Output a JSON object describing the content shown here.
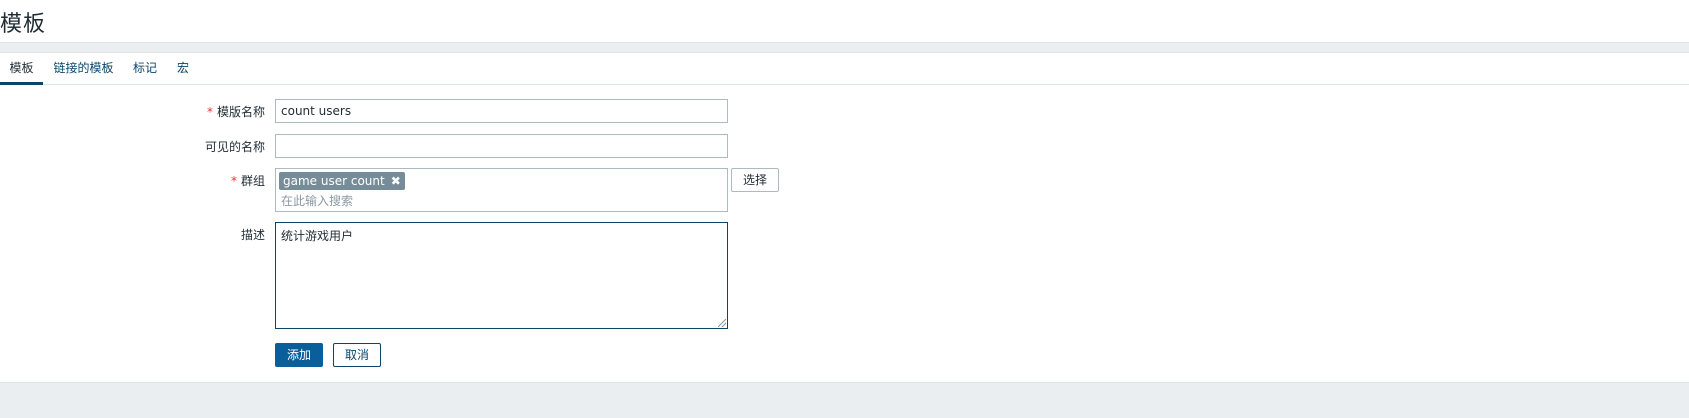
{
  "page": {
    "title": "模板"
  },
  "tabs": [
    {
      "label": "模板",
      "active": true
    },
    {
      "label": "链接的模板",
      "active": false
    },
    {
      "label": "标记",
      "active": false
    },
    {
      "label": "宏",
      "active": false
    }
  ],
  "form": {
    "template_name": {
      "label": "模版名称",
      "required": true,
      "value": "count users"
    },
    "visible_name": {
      "label": "可见的名称",
      "required": false,
      "value": ""
    },
    "groups": {
      "label": "群组",
      "required": true,
      "tags": [
        "game user count"
      ],
      "search_placeholder": "在此输入搜索",
      "select_button": "选择"
    },
    "description": {
      "label": "描述",
      "value": "统计游戏用户"
    },
    "add_button": "添加",
    "cancel_button": "取消"
  },
  "icons": {
    "tag_remove": "close-x-icon",
    "required_marker": "asterisk"
  },
  "colors": {
    "primary": "#0a5f9a",
    "link": "#0a466a",
    "required": "#e33734",
    "tag_bg": "#768d99",
    "band": "#ebeef0"
  }
}
